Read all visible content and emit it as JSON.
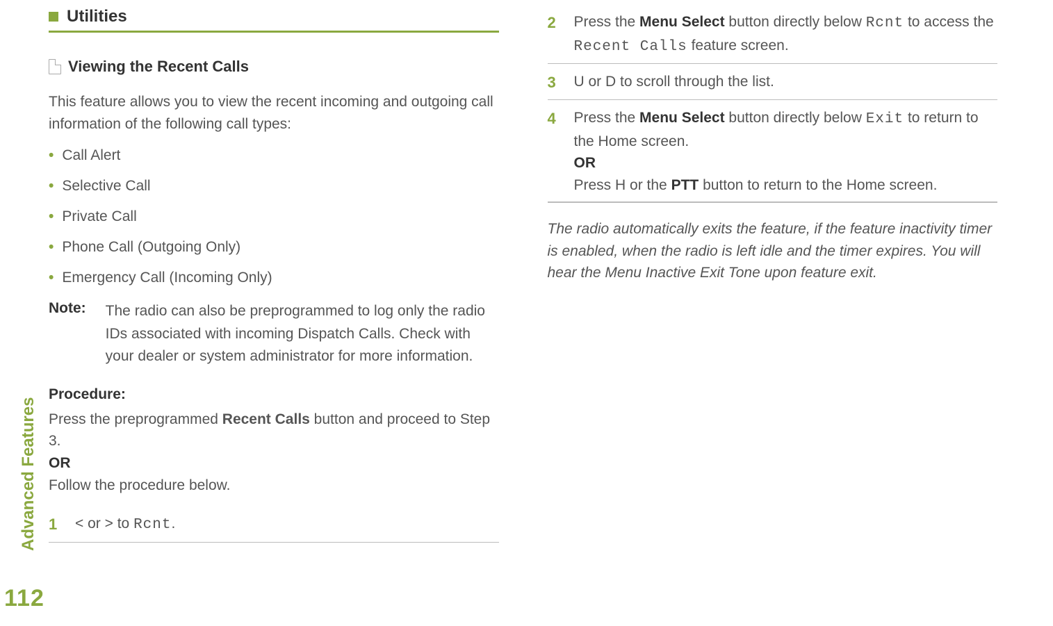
{
  "sidebar": {
    "label": "Advanced Features",
    "page_number": "112"
  },
  "left": {
    "section_title": "Utilities",
    "sub_title": "Viewing the Recent Calls",
    "intro": "This feature allows you to view the recent incoming and outgoing call information of the following call types:",
    "bullets": [
      "Call Alert",
      "Selective Call",
      "Private Call",
      "Phone Call (Outgoing Only)",
      "Emergency Call (Incoming Only)"
    ],
    "note_label": "Note:",
    "note_body": "The radio can also be preprogrammed to log only the radio IDs associated with incoming Dispatch Calls. Check with your dealer or system administrator for more information.",
    "procedure_label": "Procedure:",
    "procedure_intro_1a": "Press the preprogrammed ",
    "procedure_intro_1b": "Recent Calls",
    "procedure_intro_1c": " button and proceed to Step 3.",
    "procedure_or": "OR",
    "procedure_intro_2": "Follow the procedure below.",
    "step1": {
      "num": "1",
      "sym_a": "<",
      "mid": " or ",
      "sym_b": ">",
      "mid2": " to ",
      "code": "Rcnt",
      "end": "."
    }
  },
  "right": {
    "step2": {
      "num": "2",
      "t1": "Press the ",
      "b1": "Menu Select",
      "t2": " button directly below ",
      "c1": "Rcnt",
      "t3": " to access the ",
      "c2": "Recent Calls",
      "t4": " feature screen."
    },
    "step3": {
      "num": "3",
      "sym_a": "U",
      "mid": " or ",
      "sym_b": "D",
      "end": " to scroll through the list."
    },
    "step4": {
      "num": "4",
      "t1": "Press the ",
      "b1": "Menu Select",
      "t2": " button directly below ",
      "c1": "Exit",
      "t3": " to return to the Home screen.",
      "or": "OR",
      "t4": "Press ",
      "sym": "H",
      "t5": " or the ",
      "b2": "PTT",
      "t6": " button to return to the Home screen."
    },
    "closing": "The radio automatically exits the feature, if the feature inactivity timer is enabled, when the radio is left idle and the timer expires. You will hear the Menu Inactive Exit Tone upon feature exit."
  }
}
